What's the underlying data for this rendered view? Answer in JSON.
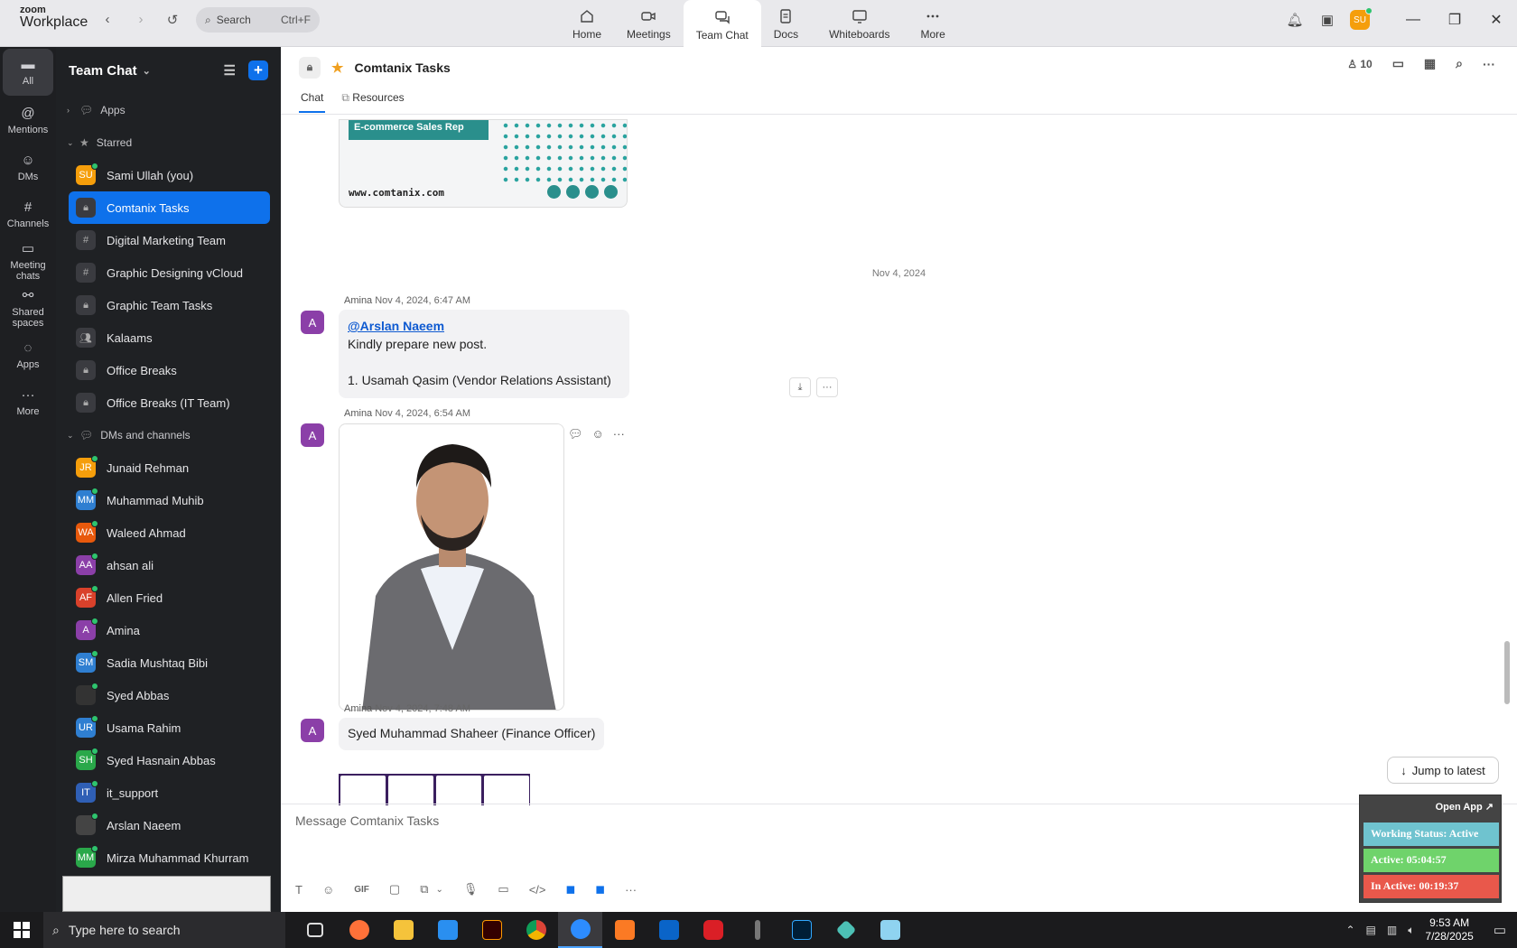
{
  "app": {
    "logo_top": "zoom",
    "logo_bottom": "Workplace"
  },
  "search": {
    "label": "Search",
    "shortcut": "Ctrl+F"
  },
  "top_tabs": [
    {
      "label": "Home",
      "icon": "home-icon"
    },
    {
      "label": "Meetings",
      "icon": "video-icon"
    },
    {
      "label": "Team Chat",
      "icon": "chat-icon"
    },
    {
      "label": "Docs",
      "icon": "doc-icon"
    },
    {
      "label": "Whiteboards",
      "icon": "whiteboard-icon"
    },
    {
      "label": "More",
      "icon": "more-icon"
    }
  ],
  "user_initials": "SU",
  "rail": [
    {
      "label": "All",
      "icon": "chat-bubble-icon"
    },
    {
      "label": "Mentions",
      "icon": "at-icon"
    },
    {
      "label": "DMs",
      "icon": "people-icon"
    },
    {
      "label": "Channels",
      "icon": "hash-icon"
    },
    {
      "label": "Meeting chats",
      "icon": "calendar-icon"
    },
    {
      "label": "Shared spaces",
      "icon": "shared-icon"
    },
    {
      "label": "Apps",
      "icon": "apps-icon"
    },
    {
      "label": "More",
      "icon": "more-icon"
    }
  ],
  "sidebar": {
    "title": "Team Chat",
    "sections": {
      "apps": "Apps",
      "starred": "Starred",
      "dms": "DMs and channels"
    },
    "starred": [
      {
        "label": "Sami Ullah (you)",
        "initials": "SU",
        "color": "#f59e0b",
        "type": "user"
      },
      {
        "label": "Comtanix Tasks",
        "type": "lock",
        "selected": true
      },
      {
        "label": "Digital Marketing Team",
        "type": "hash"
      },
      {
        "label": "Graphic Designing vCloud",
        "type": "hash"
      },
      {
        "label": "Graphic Team Tasks",
        "type": "lock"
      },
      {
        "label": "Kalaams",
        "type": "group"
      },
      {
        "label": "Office Breaks",
        "type": "lock"
      },
      {
        "label": "Office Breaks (IT Team)",
        "type": "lock"
      }
    ],
    "dms": [
      {
        "label": "Junaid Rehman",
        "initials": "JR",
        "color": "#f59e0b"
      },
      {
        "label": "Muhammad Muhib",
        "initials": "MM",
        "color": "#2f7fd1"
      },
      {
        "label": "Waleed Ahmad",
        "initials": "WA",
        "color": "#e8590c"
      },
      {
        "label": "ahsan ali",
        "initials": "AA",
        "color": "#8b3fa8"
      },
      {
        "label": "Allen Fried",
        "initials": "AF",
        "color": "#d9412b"
      },
      {
        "label": "Amina",
        "initials": "A",
        "color": "#8b3fa8"
      },
      {
        "label": "Sadia Mushtaq Bibi",
        "initials": "SM",
        "color": "#2f7fd1"
      },
      {
        "label": "Syed Abbas",
        "initials": "",
        "color": "#333333"
      },
      {
        "label": "Usama Rahim",
        "initials": "UR",
        "color": "#2f7fd1"
      },
      {
        "label": "Syed Hasnain Abbas",
        "initials": "SH",
        "color": "#2aa84a"
      },
      {
        "label": "it_support",
        "initials": "IT",
        "color": "#2f5fb5"
      },
      {
        "label": "Arslan Naeem",
        "initials": "",
        "color": "#444444"
      },
      {
        "label": "Mirza Muhammad Khurram",
        "initials": "MM",
        "color": "#2aa84a"
      }
    ]
  },
  "channel": {
    "title": "Comtanix Tasks",
    "member_count": "10",
    "tabs": [
      "Chat",
      "Resources"
    ]
  },
  "messages": {
    "banner": {
      "tag": "E-commerce Sales Rep",
      "url": "www.comtanix.com"
    },
    "date_separator": "Nov 4, 2024",
    "m1": {
      "author": "Amina",
      "time": "Nov 4, 2024, 6:47 AM",
      "mention": "@Arslan Naeem",
      "line1": "Kindly prepare new post.",
      "line2": "1. Usamah Qasim (Vendor Relations Assistant)"
    },
    "m2": {
      "author": "Amina",
      "time": "Nov 4, 2024, 6:54 AM"
    },
    "m3": {
      "author": "Amina",
      "time": "Nov 4, 2024, 7:48 AM",
      "text": "Syed Muhammad Shaheer (Finance Officer)"
    }
  },
  "jump_label": "Jump to latest",
  "composer_placeholder": "Message Comtanix Tasks",
  "widget": {
    "open_app": "Open App ↗",
    "working": "Working Status: Active",
    "active": "Active: 05:04:57",
    "inactive": "In Active: 00:19:37",
    "colors": {
      "working": "#6fc3cf",
      "active": "#6fd36b",
      "inactive": "#e9584b"
    }
  },
  "taskbar": {
    "search_placeholder": "Type here to search",
    "time": "9:53 AM",
    "date": "7/28/2025"
  }
}
